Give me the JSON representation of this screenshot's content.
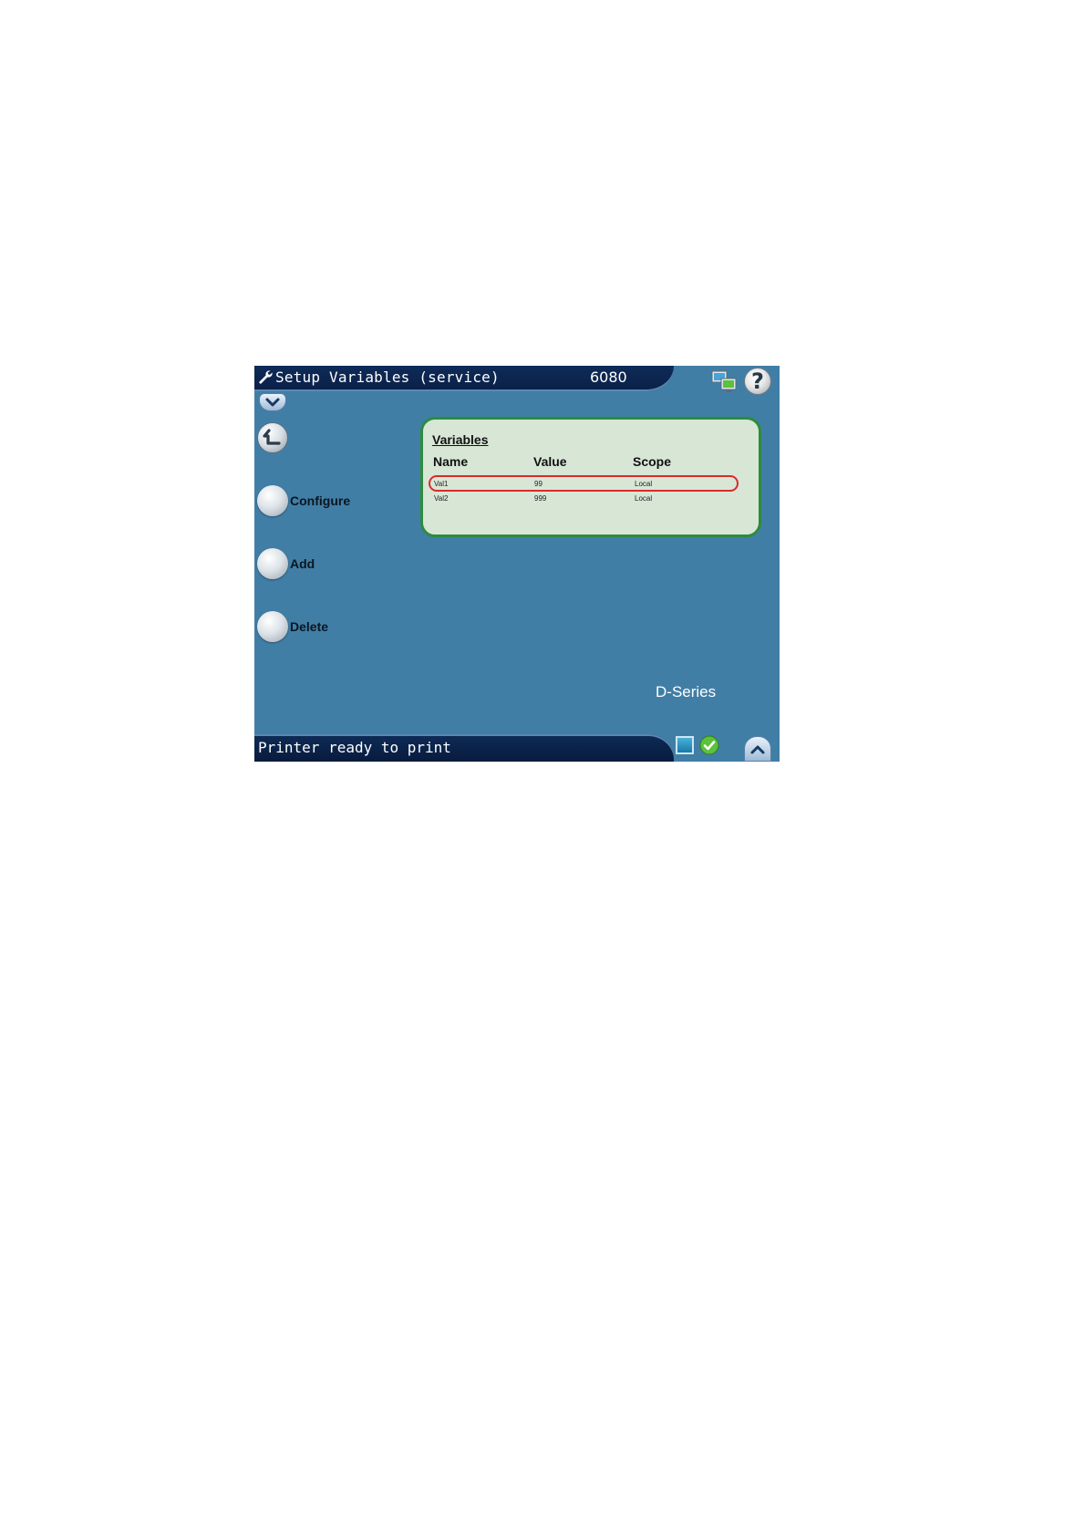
{
  "header": {
    "title": "Setup Variables (service)",
    "code": "6080",
    "help_label": "?"
  },
  "icons": {
    "settings": "wrench-icon",
    "network": "network-icon",
    "help": "help-icon",
    "scroll_down": "chevron-down-icon",
    "back": "back-arrow-icon",
    "status": "check-circle-icon",
    "scroll_up": "chevron-up-icon"
  },
  "sidebar": {
    "items": [
      {
        "label": "Configure"
      },
      {
        "label": "Add"
      },
      {
        "label": "Delete"
      }
    ]
  },
  "variables_panel": {
    "title": "Variables",
    "columns": [
      "Name",
      "Value",
      "Scope"
    ],
    "rows": [
      {
        "name": "Val1",
        "value": "99",
        "scope": "Local",
        "selected": true
      },
      {
        "name": "Val2",
        "value": "999",
        "scope": "Local",
        "selected": false
      }
    ]
  },
  "brand": "D-Series",
  "status": {
    "text": "Printer ready to print"
  },
  "colors": {
    "screen_bg": "#417ea6",
    "bar_bg": "#0e2b57",
    "panel_bg": "#d8e6d6",
    "panel_border": "#2e8b3e",
    "selection": "#d92b2b",
    "status_ok": "#5cc23a"
  }
}
